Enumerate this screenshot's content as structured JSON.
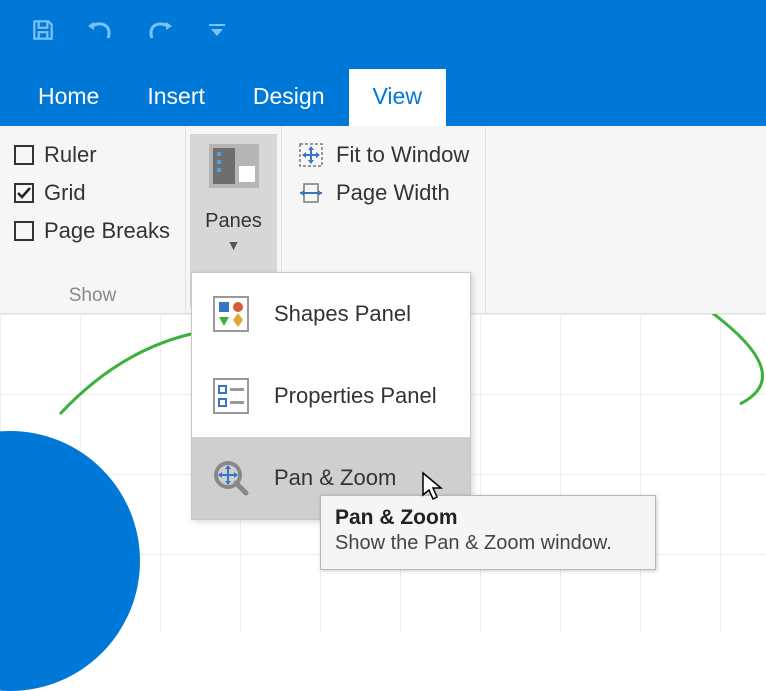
{
  "qat": {
    "buttons": [
      "save",
      "undo",
      "redo",
      "customize"
    ]
  },
  "tabs": [
    {
      "label": "Home",
      "active": false
    },
    {
      "label": "Insert",
      "active": false
    },
    {
      "label": "Design",
      "active": false
    },
    {
      "label": "View",
      "active": true
    }
  ],
  "ribbon": {
    "show": {
      "title": "Show",
      "items": [
        {
          "label": "Ruler",
          "checked": false
        },
        {
          "label": "Grid",
          "checked": true
        },
        {
          "label": "Page Breaks",
          "checked": false
        }
      ]
    },
    "panes": {
      "label": "Panes"
    },
    "zoom": {
      "fit": "Fit to Window",
      "pagewidth": "Page Width"
    }
  },
  "menu": {
    "items": [
      {
        "label": "Shapes Panel",
        "hover": false
      },
      {
        "label": "Properties Panel",
        "hover": false
      },
      {
        "label": "Pan & Zoom",
        "hover": true
      }
    ]
  },
  "tooltip": {
    "title": "Pan & Zoom",
    "body": "Show the Pan & Zoom window."
  }
}
